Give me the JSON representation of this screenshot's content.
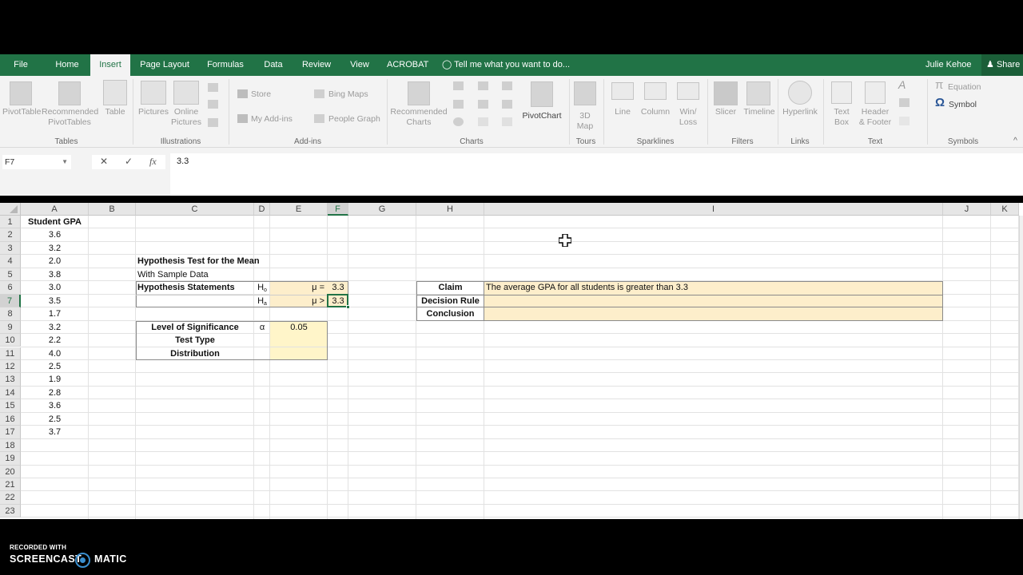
{
  "app": {
    "tabs": [
      {
        "label": "File",
        "active": false
      },
      {
        "label": "Home",
        "active": false
      },
      {
        "label": "Insert",
        "active": true
      },
      {
        "label": "Page Layout",
        "active": false
      },
      {
        "label": "Formulas",
        "active": false
      },
      {
        "label": "Data",
        "active": false
      },
      {
        "label": "Review",
        "active": false
      },
      {
        "label": "View",
        "active": false
      },
      {
        "label": "ACROBAT",
        "active": false
      }
    ],
    "tell_me": "Tell me what you want to do...",
    "user_name": "Julie Kehoe",
    "share_label": "Share"
  },
  "ribbon": {
    "groups": {
      "tables": "Tables",
      "illustrations": "Illustrations",
      "addins": "Add-ins",
      "charts": "Charts",
      "tours": "Tours",
      "sparklines": "Sparklines",
      "filters": "Filters",
      "links": "Links",
      "text": "Text",
      "symbols": "Symbols"
    },
    "buttons": {
      "pivottable": "PivotTable",
      "recommended_pivottables_1": "Recommended",
      "recommended_pivottables_2": "PivotTables",
      "table": "Table",
      "pictures": "Pictures",
      "online_pictures_1": "Online",
      "online_pictures_2": "Pictures",
      "store": "Store",
      "my_addins": "My Add-ins",
      "bing_maps": "Bing Maps",
      "people_graph": "People Graph",
      "recommended_charts_1": "Recommended",
      "recommended_charts_2": "Charts",
      "pivotchart": "PivotChart",
      "map3d_1": "3D",
      "map3d_2": "Map",
      "line": "Line",
      "column": "Column",
      "winloss_1": "Win/",
      "winloss_2": "Loss",
      "slicer": "Slicer",
      "timeline": "Timeline",
      "hyperlink": "Hyperlink",
      "textbox_1": "Text",
      "textbox_2": "Box",
      "header_footer_1": "Header",
      "header_footer_2": "& Footer",
      "equation": "Equation",
      "symbol": "Symbol"
    }
  },
  "formula_bar": {
    "name_box": "F7",
    "cancel": "✕",
    "enter": "✓",
    "fx": "fx",
    "value": "3.3"
  },
  "sheet": {
    "columns": [
      "A",
      "B",
      "C",
      "D",
      "E",
      "F",
      "G",
      "H",
      "I",
      "J",
      "K"
    ],
    "selected_column": "F",
    "rows": [
      "1",
      "2",
      "3",
      "4",
      "5",
      "6",
      "7",
      "8",
      "9",
      "10",
      "11",
      "12",
      "13",
      "14",
      "15",
      "16",
      "17",
      "18",
      "19",
      "20",
      "21",
      "22",
      "23"
    ],
    "selected_row": "7",
    "active_cell": "F7",
    "gpa_header": "Student GPA",
    "gpa_values": [
      "3.6",
      "3.2",
      "2.0",
      "3.8",
      "3.0",
      "3.5",
      "1.7",
      "3.2",
      "2.2",
      "4.0",
      "2.5",
      "1.9",
      "2.8",
      "3.6",
      "2.5",
      "3.7"
    ],
    "title": "Hypothesis Test for the Mean",
    "subtitle": "With Sample Data",
    "hypothesis_label": "Hypothesis Statements",
    "h0_label": "H",
    "h0_sub": "o",
    "ha_label": "H",
    "ha_sub": "a",
    "h0_op": "μ =",
    "h0_value": "3.3",
    "ha_op": "μ >",
    "ha_value": "3.3",
    "significance_label": "Level of Significance",
    "alpha_symbol": "α",
    "alpha_value": "0.05",
    "test_type_label": "Test Type",
    "test_type_value": "",
    "distribution_label": "Distribution",
    "distribution_value": "",
    "claim_label": "Claim",
    "claim_value": "The average GPA for all students is greater than 3.3",
    "decision_rule_label": "Decision Rule",
    "decision_rule_value": "",
    "conclusion_label": "Conclusion",
    "conclusion_value": ""
  },
  "watermark": {
    "line1": "RECORDED WITH",
    "brand_left": "SCREENCAST",
    "brand_right": "MATIC"
  },
  "colors": {
    "excel_green": "#217346",
    "input_tan": "#fdeecb",
    "input_yellow": "#fff5c9"
  }
}
